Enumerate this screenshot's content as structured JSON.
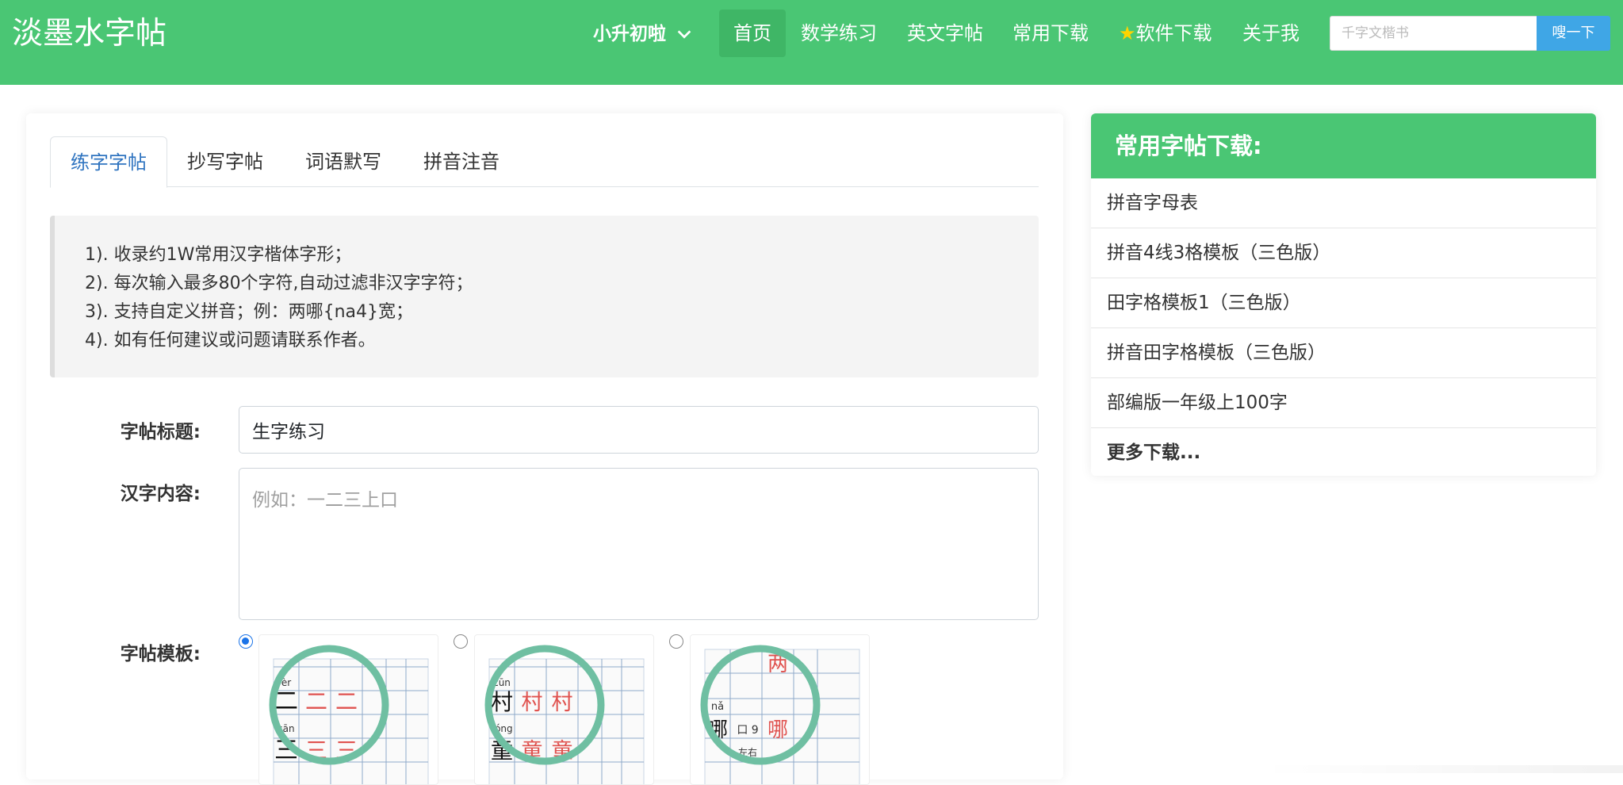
{
  "navbar": {
    "brand": "淡墨水字帖",
    "dropdown_label": "小升初啦",
    "items": [
      {
        "label": "首页",
        "active": true
      },
      {
        "label": "数学练习"
      },
      {
        "label": "英文字帖"
      },
      {
        "label": "常用下载"
      },
      {
        "label": "软件下载",
        "icon": "star-icon"
      },
      {
        "label": "关于我"
      }
    ],
    "search_placeholder": "千字文楷书",
    "search_button": "嗖一下"
  },
  "tabs": [
    {
      "label": "练字字帖",
      "active": true
    },
    {
      "label": "抄写字帖"
    },
    {
      "label": "词语默写"
    },
    {
      "label": "拼音注音"
    }
  ],
  "notes": [
    "1). 收录约1W常用汉字楷体字形；",
    "2). 每次输入最多80个字符,自动过滤非汉字字符；",
    "3). 支持自定义拼音；例：两哪{na4}宽；",
    "4). 如有任何建议或问题请联系作者。"
  ],
  "form": {
    "title_label": "字帖标题:",
    "title_value": "生字练习",
    "content_label": "汉字内容:",
    "content_placeholder": "例如：一二三上口",
    "template_label": "字帖模板:",
    "templates": [
      {
        "selected": true,
        "pinyin": [
          "èr",
          "sān"
        ],
        "chars": [
          "二",
          "三"
        ]
      },
      {
        "selected": false,
        "pinyin": [
          "cūn",
          "tóng"
        ],
        "chars": [
          "村",
          "童"
        ]
      },
      {
        "selected": false,
        "pinyin": [
          "nǎ",
          "口 9",
          "左右"
        ],
        "chars": [
          "两",
          "哪"
        ]
      }
    ]
  },
  "sidebar": {
    "title": "常用字帖下载:",
    "items": [
      "拼音字母表",
      "拼音4线3格模板（三色版）",
      "田字格模板1（三色版）",
      "拼音田字格模板（三色版）",
      "部编版一年级上100字"
    ],
    "more": "更多下载..."
  },
  "colors": {
    "brand_green": "#4ac674",
    "active_tab": "#2f74c0",
    "search_button": "#3fa6e6",
    "template_ring": "#6fbfa2",
    "template_red": "#e0524f"
  }
}
